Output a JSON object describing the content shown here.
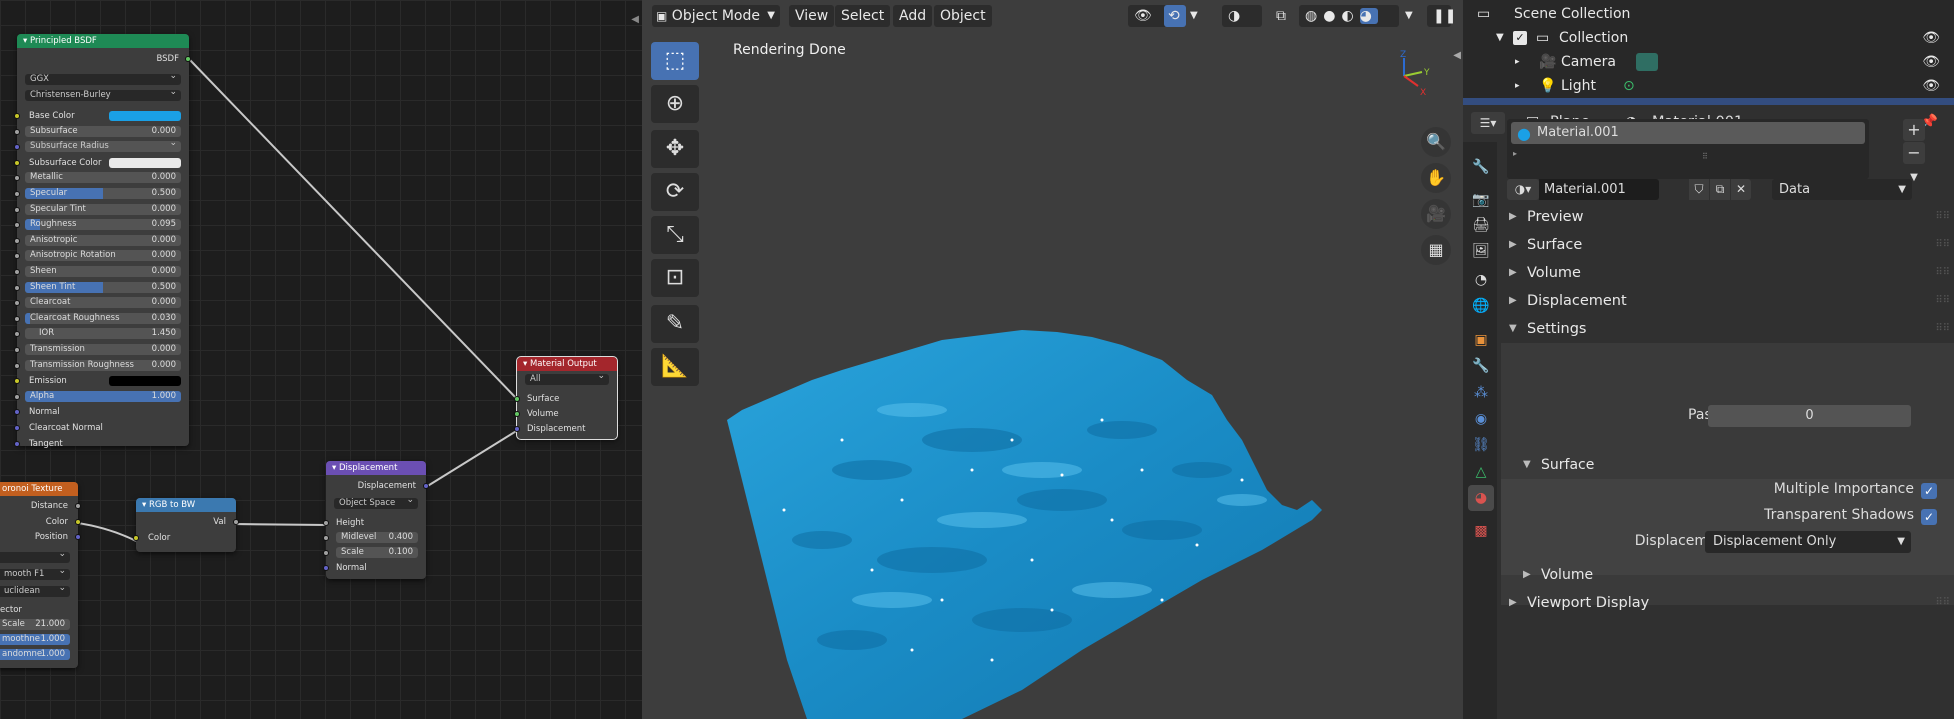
{
  "node_editor": {
    "bsdf": {
      "title": "Principled BSDF",
      "output": "BSDF",
      "distribution": "GGX",
      "subsurface_method": "Christensen-Burley",
      "rows": [
        {
          "label": "Base Color",
          "kind": "color",
          "color": "#1aa0e6"
        },
        {
          "label": "Subsurface",
          "value": "0.000",
          "kind": "num",
          "fill": 0
        },
        {
          "label": "Subsurface Radius",
          "kind": "drop"
        },
        {
          "label": "Subsurface Color",
          "kind": "color",
          "color": "#e8e8e8"
        },
        {
          "label": "Metallic",
          "value": "0.000",
          "kind": "num",
          "fill": 0
        },
        {
          "label": "Specular",
          "value": "0.500",
          "kind": "num",
          "fill": 0.5
        },
        {
          "label": "Specular Tint",
          "value": "0.000",
          "kind": "num",
          "fill": 0
        },
        {
          "label": "Roughness",
          "value": "0.095",
          "kind": "num",
          "fill": 0.095
        },
        {
          "label": "Anisotropic",
          "value": "0.000",
          "kind": "num",
          "fill": 0
        },
        {
          "label": "Anisotropic Rotation",
          "value": "0.000",
          "kind": "num",
          "fill": 0
        },
        {
          "label": "Sheen",
          "value": "0.000",
          "kind": "num",
          "fill": 0
        },
        {
          "label": "Sheen Tint",
          "value": "0.500",
          "kind": "num",
          "fill": 0.5
        },
        {
          "label": "Clearcoat",
          "value": "0.000",
          "kind": "num",
          "fill": 0
        },
        {
          "label": "Clearcoat Roughness",
          "value": "0.030",
          "kind": "num",
          "fill": 0.03
        },
        {
          "label": "IOR",
          "value": "1.450",
          "kind": "ior"
        },
        {
          "label": "Transmission",
          "value": "0.000",
          "kind": "num",
          "fill": 0
        },
        {
          "label": "Transmission Roughness",
          "value": "0.000",
          "kind": "num",
          "fill": 0
        },
        {
          "label": "Emission",
          "kind": "color",
          "color": "#000000"
        },
        {
          "label": "Alpha",
          "value": "1.000",
          "kind": "num",
          "fill": 1
        },
        {
          "label": "Normal",
          "kind": "plain"
        },
        {
          "label": "Clearcoat Normal",
          "kind": "plain"
        },
        {
          "label": "Tangent",
          "kind": "plain"
        }
      ]
    },
    "material_output": {
      "title": "Material Output",
      "target": "All",
      "inputs": [
        "Surface",
        "Volume",
        "Displacement"
      ]
    },
    "displacement": {
      "title": "Displacement",
      "output": "Displacement",
      "space": "Object Space",
      "height": "Height",
      "midlevel_label": "Midlevel",
      "midlevel": "0.400",
      "scale_label": "Scale",
      "scale": "0.100",
      "normal": "Normal"
    },
    "rgb_to_bw": {
      "title": "RGB to BW",
      "output": "Val",
      "input": "Color"
    },
    "voronoi": {
      "title": "oronoi Texture",
      "outputs": [
        "Distance",
        "Color",
        "Position"
      ],
      "feature": "mooth F1",
      "metric": "uclidean",
      "vector": "ector",
      "scale_label": "Scale",
      "scale": "21.000",
      "smooth_label": "moothne",
      "smooth": "1.000",
      "random_label": "andomne",
      "random": "1.000"
    }
  },
  "viewport": {
    "mode": "Object Mode",
    "menus": [
      "View",
      "Select",
      "Add",
      "Object"
    ],
    "status": "Rendering Done",
    "gizmo_axes": [
      "X",
      "Y",
      "Z"
    ]
  },
  "outliner": {
    "root": "Scene Collection",
    "items": [
      "Collection",
      "Camera",
      "Light"
    ]
  },
  "properties": {
    "object": "Plane",
    "material": "Material.001",
    "slot": "Material.001",
    "data_link": "Data",
    "panels": [
      "Preview",
      "Surface",
      "Volume",
      "Displacement",
      "Settings"
    ],
    "pass_index_label": "Pass Index",
    "pass_index": "0",
    "surface_sub": "Surface",
    "multiple_importance": "Multiple Importance",
    "transparent_shadows": "Transparent Shadows",
    "displacement_label": "Displacement",
    "displacement_value": "Displacement Only",
    "volume_sub": "Volume",
    "viewport_display": "Viewport Display"
  },
  "colors": {
    "accent": "#4772b3",
    "water": "#1c8fc9",
    "bsdf_header": "#1e8a55",
    "output_header": "#a4262c",
    "vector_header": "#6b4fb3",
    "converter_header": "#3b79b0",
    "texture_header": "#c25f1f"
  }
}
